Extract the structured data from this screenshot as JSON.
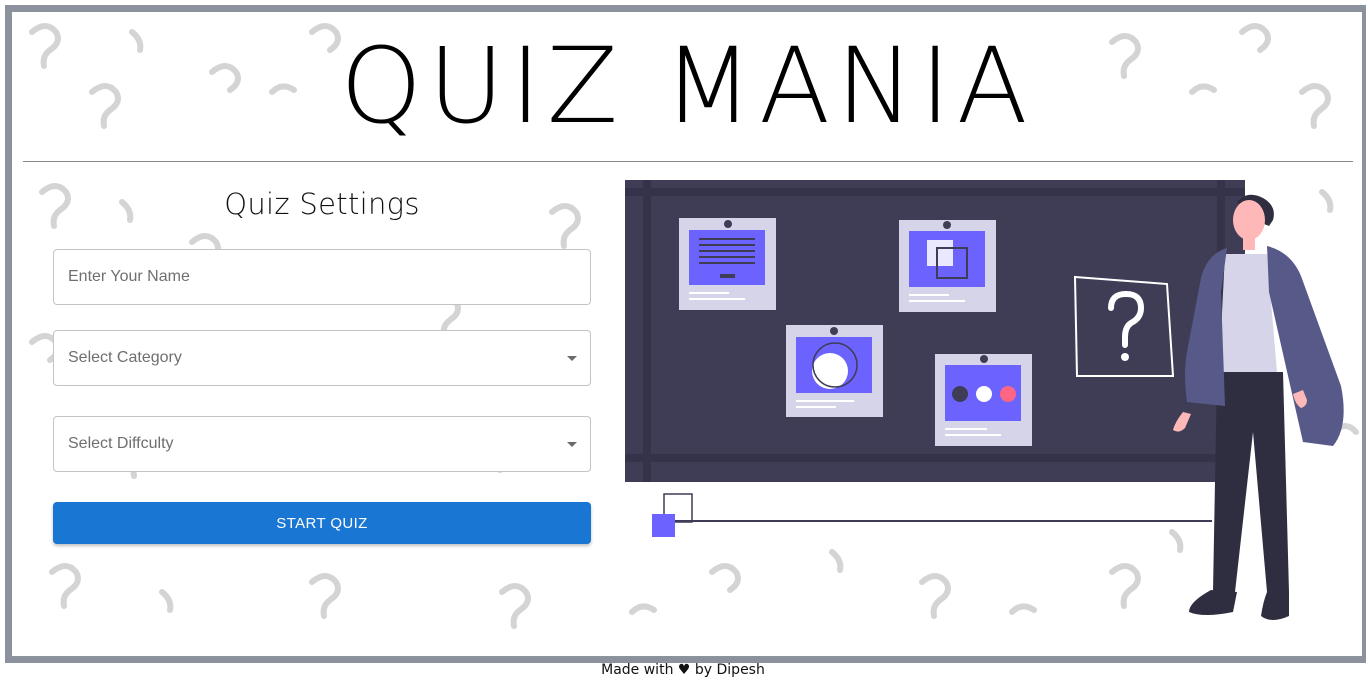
{
  "header": {
    "title": "QUIZ MANIA"
  },
  "settings": {
    "title": "Quiz Settings",
    "name_placeholder": "Enter Your Name",
    "category_label": "Select Category",
    "difficulty_label": "Select Diffculty",
    "start_label": "START QUIZ"
  },
  "illustration": {
    "board_mark": "?",
    "icon": "quiz-presenter-illustration"
  },
  "footer": {
    "text": "Made with ♥ by Dipesh"
  },
  "colors": {
    "accent": "#1976d2",
    "frame": "#8c919e",
    "board": "#3f3d56",
    "card_accent": "#6c63ff",
    "dot_pink": "#ff6584"
  }
}
